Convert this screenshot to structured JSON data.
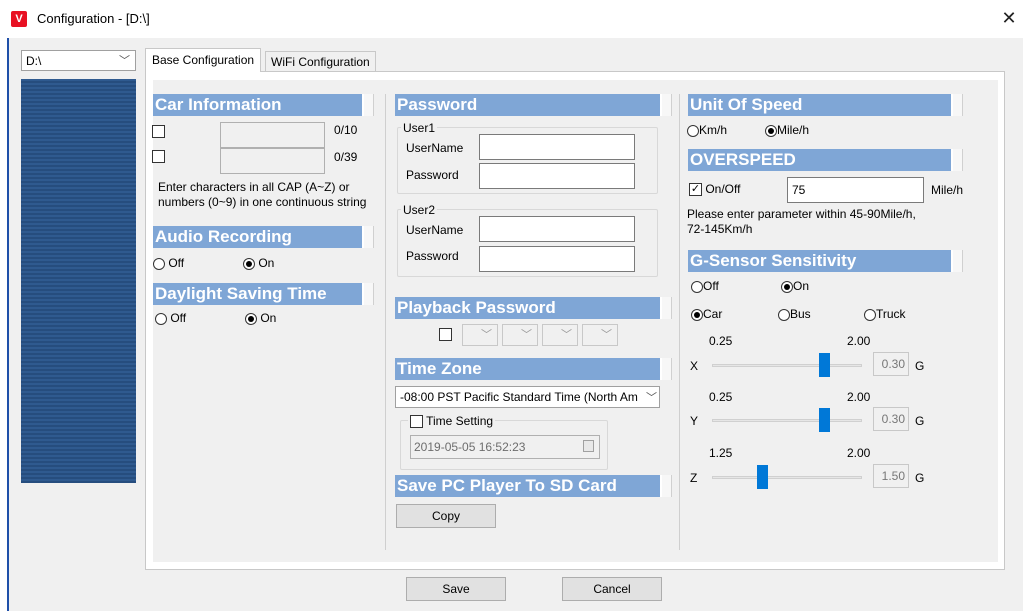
{
  "window": {
    "title": "Configuration - [D:\\]",
    "close_glyph": "✕"
  },
  "drive": {
    "selected": "D:\\"
  },
  "tabs": {
    "base": "Base Configuration",
    "wifi": "WiFi Configuration"
  },
  "car_info": {
    "header": "Car Information",
    "count1": "0/10",
    "count2": "0/39",
    "hint_line1": "Enter characters in all CAP (A~Z) or",
    "hint_line2": "numbers (0~9) in one continuous string"
  },
  "audio": {
    "header": "Audio Recording",
    "off": "Off",
    "on": "On",
    "selected": "On"
  },
  "dst": {
    "header": "Daylight Saving Time",
    "off": "Off",
    "on": "On",
    "selected": "On"
  },
  "password": {
    "header": "Password",
    "user1": "User1",
    "user2": "User2",
    "username_label": "UserName",
    "password_label": "Password"
  },
  "playback": {
    "header": "Playback Password"
  },
  "timezone": {
    "header": "Time Zone",
    "selected": "-08:00 PST Pacific Standard Time (North Am",
    "time_setting": "Time Setting",
    "datetime": "2019-05-05 16:52:23"
  },
  "save_pc": {
    "header": "Save PC Player To SD Card",
    "copy": "Copy"
  },
  "speed": {
    "header": "Unit Of Speed",
    "kmh": "Km/h",
    "mileh": "Mile/h",
    "selected": "Mile/h"
  },
  "overspeed": {
    "header": "OVERSPEED",
    "onoff": "On/Off",
    "value": "75",
    "unit": "Mile/h",
    "hint_line1": "Please enter parameter within 45-90Mile/h,",
    "hint_line2": "72-145Km/h"
  },
  "gsensor": {
    "header": "G-Sensor Sensitivity",
    "off": "Off",
    "on": "On",
    "car": "Car",
    "bus": "Bus",
    "truck": "Truck",
    "unit": "G",
    "x": {
      "label": "X",
      "min": "0.25",
      "max": "2.00",
      "value": "0.30"
    },
    "y": {
      "label": "Y",
      "min": "0.25",
      "max": "2.00",
      "value": "0.30"
    },
    "z": {
      "label": "Z",
      "min": "1.25",
      "max": "2.00",
      "value": "1.50"
    }
  },
  "buttons": {
    "save": "Save",
    "cancel": "Cancel"
  },
  "colors": {
    "section_header": "#7fa6d6",
    "slider_thumb": "#0078d7",
    "app_icon": "#e81123"
  }
}
